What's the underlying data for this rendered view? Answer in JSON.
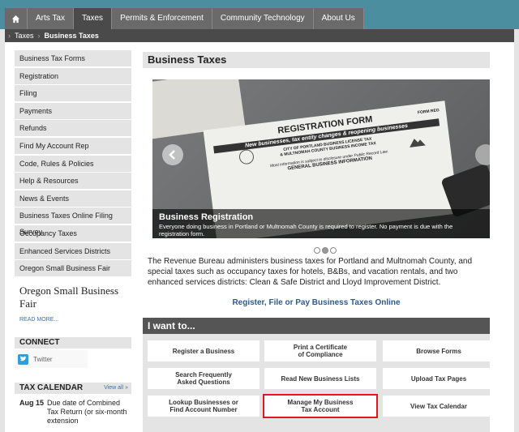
{
  "topnav": {
    "items": [
      "Arts Tax",
      "Taxes",
      "Permits & Enforcement",
      "Community Technology",
      "About Us"
    ],
    "active": "Taxes"
  },
  "breadcrumb": [
    "Taxes",
    "Business Taxes"
  ],
  "sidebar": {
    "items": [
      "Business Tax Forms",
      "Registration",
      "Filing",
      "Payments",
      "Refunds",
      "Find My Account Rep",
      "Code, Rules & Policies",
      "Help & Resources",
      "News & Events",
      "Business Taxes Online Filing Survey",
      "Occupancy Taxes",
      "Enhanced Services Districts",
      "Oregon Small Business Fair"
    ],
    "feature_title": "Oregon Small Business Fair",
    "read_more": "READ MORE..."
  },
  "connect": {
    "title": "CONNECT",
    "twitter": "Twitter"
  },
  "calendar": {
    "title": "TAX CALENDAR",
    "view_all": "View all »",
    "date": "Aug 15",
    "event": "Due date of Combined Tax Return (or six-month extension"
  },
  "main": {
    "title": "Business Taxes",
    "slide": {
      "title": "Business Registration",
      "text": "Everyone doing business in Portland or Multnomah County is required to register. No payment is due with the registration form.",
      "form_title": "REGISTRATION FORM",
      "form_subtitle": "New businesses, tax entity changes & reopening businesses",
      "form_line1": "CITY OF PORTLAND BUSINESS LICENSE TAX",
      "form_line2": "& MULTNOMAH COUNTY BUSINESS INCOME TAX",
      "form_line3": "Most information is subject to disclosure under Public Record Law.",
      "form_line4": "GENERAL BUSINESS INFORMATION",
      "form_code": "FORM REG"
    },
    "intro": "The Revenue Bureau administers business taxes for Portland and Multnomah County, and special taxes such as occupancy taxes for hotels, B&Bs, and vacation rentals, and two enhanced services districts: Clean & Safe District and Lloyd Improvement District.",
    "link": "Register, File or Pay Business Taxes Online",
    "iwant_title": "I want to...",
    "buttons": [
      "Register a Business",
      "Print a Certificate\nof Compliance",
      "Browse Forms",
      "Search Frequently\nAsked Questions",
      "Read New Business Lists",
      "Upload Tax Pages",
      "Lookup Businesses or\nFind Account Number",
      "Manage My Business\nTax Account",
      "View Tax Calendar"
    ]
  },
  "colors": {
    "accent": "#4a8ea0",
    "nav": "#6a6a6a",
    "highlight": "#e2161c",
    "twitter": "#2e9fd8"
  }
}
